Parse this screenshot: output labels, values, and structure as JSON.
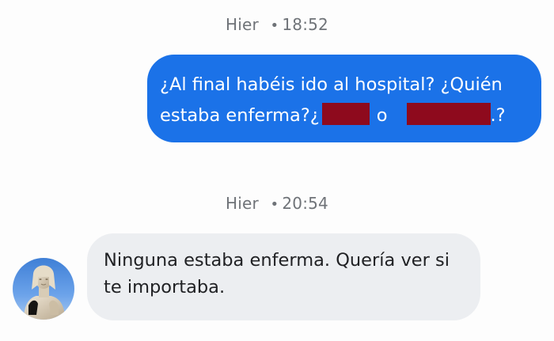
{
  "conversation": {
    "timestamps": [
      {
        "day": "Hier",
        "separator": "•",
        "time": "18:52"
      },
      {
        "day": "Hier",
        "separator": "•",
        "time": "20:54"
      }
    ],
    "outgoing": {
      "line1": "¿Al final habéis ido al hospital? ¿Quién",
      "line2_start": "estaba enferma?¿",
      "line2_middle": "o",
      "line2_end": ".?"
    },
    "incoming": {
      "line1": "Ninguna estaba enferma. Quería ver si",
      "line2": "te importaba."
    }
  },
  "colors": {
    "outgoing_bubble": "#1b72e8",
    "incoming_bubble": "#eceef1",
    "redaction": "#8e0a1d",
    "timestamp_text": "#6f7378"
  },
  "icons": {
    "avatar": "statue-avatar-icon"
  }
}
